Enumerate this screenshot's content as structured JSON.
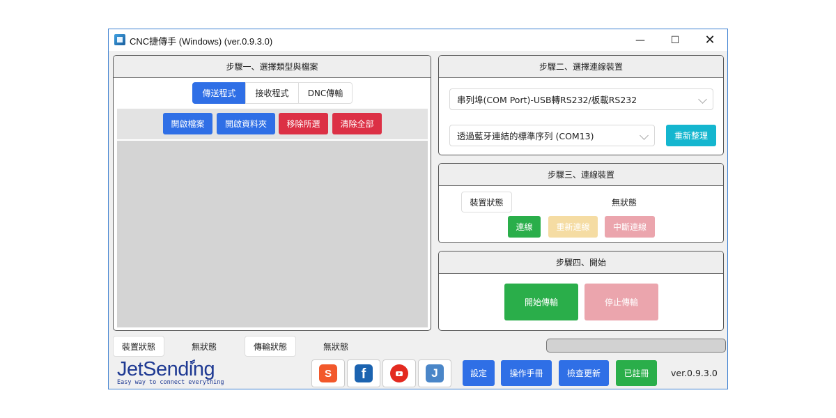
{
  "window": {
    "title": "CNC捷傳手 (Windows)  (ver.0.9.3.0)",
    "min": "—",
    "max": "☐",
    "close": "✕"
  },
  "step1": {
    "header": "步驟一、選擇類型與檔案",
    "tabs": [
      "傳送程式",
      "接收程式",
      "DNC傳輸"
    ],
    "buttons": {
      "open_file": "開啟檔案",
      "open_folder": "開啟資料夾",
      "remove_selected": "移除所選",
      "clear_all": "清除全部"
    }
  },
  "step2": {
    "header": "步驟二、選擇連線裝置",
    "port_type": "串列埠(COM Port)-USB轉RS232/板載RS232",
    "port": "透過藍牙連結的標準序列 (COM13)",
    "refresh": "重新整理"
  },
  "step3": {
    "header": "步驟三、連線裝置",
    "device_status_label": "裝置狀態",
    "device_status_value": "無狀態",
    "connect": "連線",
    "reconnect": "重新連線",
    "disconnect": "中斷連線"
  },
  "step4": {
    "header": "步驟四、開始",
    "start": "開始傳輸",
    "stop": "停止傳輸"
  },
  "statusbar": {
    "device_label": "裝置狀態",
    "device_value": "無狀態",
    "transfer_label": "傳輸狀態",
    "transfer_value": "無狀態",
    "progress": 0
  },
  "footer": {
    "brand": "JetSending",
    "tagline": "Easy way to connect everything",
    "social": [
      "shopee-icon",
      "facebook-icon",
      "youtube-icon",
      "jetsending-j-icon"
    ],
    "settings": "設定",
    "manual": "操作手冊",
    "check_update": "檢查更新",
    "registered": "已註冊",
    "version": "ver.0.9.3.0"
  },
  "colors": {
    "blue": "#2f6fe6",
    "red": "#dc3045",
    "green": "#2aae4a",
    "cyan": "#14b6cf",
    "brand": "#1f3a93"
  }
}
